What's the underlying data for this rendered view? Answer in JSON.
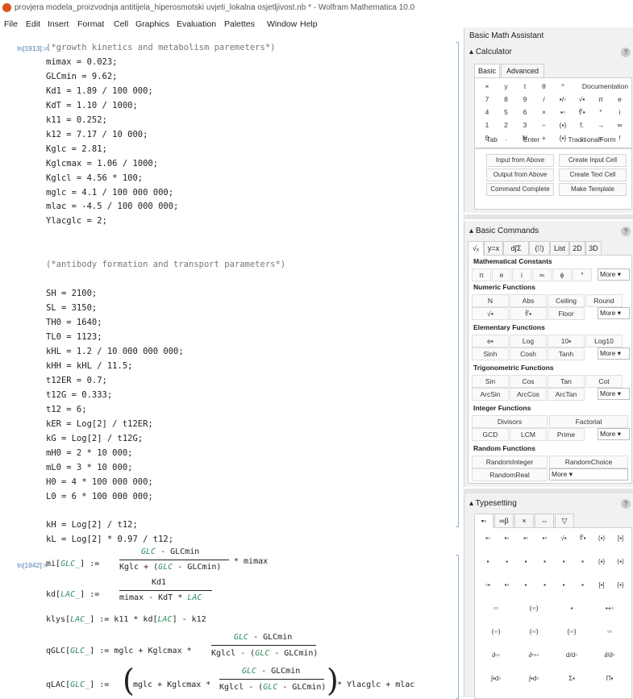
{
  "window_title": "provjera modela_proizvodnja antitijela_hiperosmotski uvjeti_lokalna osjetljivost.nb * - Wolfram Mathematica 10.0",
  "menu": [
    "File",
    "Edit",
    "Insert",
    "Format",
    "Cell",
    "Graphics",
    "Evaluation",
    "Palettes",
    "Window",
    "Help"
  ],
  "cell1": {
    "label": "In[1913]:=",
    "lines": [
      "(*growth kinetics and metabolism paremeters*)",
      "mimax = 0.023;",
      "GLCmin = 9.62;",
      "Kd1 = 1.89 / 100 000;",
      "KdT = 1.10 / 1000;",
      "k11 = 0.252;",
      "k12 = 7.17 / 10 000;",
      "Kglc = 2.81;",
      "Kglcmax = 1.06 / 1000;",
      "Kglcl = 4.56 * 100;",
      "mglc = 4.1 / 100 000 000;",
      "mlac = -4.5 / 100 000 000;",
      "Ylacglc = 2;",
      "",
      "",
      "(*antibody formation and transport parameters*)",
      "",
      "SH = 2100;",
      "SL = 3150;",
      "TH0 = 1640;",
      "TL0 = 1123;",
      "kHL = 1.2 / 10 000 000 000;",
      "kHH = kHL / 11.5;",
      "t12ER = 0.7;",
      "t12G = 0.333;",
      "t12 = 6;",
      "kER = Log[2] / t12ER;",
      "kG = Log[2] / t12G;",
      "mH0 = 2 * 10 000;",
      "mL0 = 3 * 10 000;",
      "H0 = 4 * 100 000 000;",
      "L0 = 6 * 100 000 000;",
      "",
      "kH = Log[2] / t12;",
      "kL = Log[2] * 0.97 / t12;"
    ]
  },
  "cell2": {
    "label": "In[1942]:=",
    "mi_lhs": "mi[",
    "mi_arg": "GLC_",
    "mi_rb": "] :=",
    "mi_num_a": "GLC",
    "mi_num_b": " - GLCmin",
    "mi_den_a": "Kglc + (",
    "mi_den_b": "GLC",
    "mi_den_c": " - GLCmin)",
    "mi_tail": "* mimax",
    "kd_lhs": "kd[",
    "kd_arg": "LAC_",
    "kd_rb": "] :=",
    "kd_num": "Kd1",
    "kd_den_a": "mimax - KdT *",
    "kd_den_b": "LAC",
    "klys_a": "klys[",
    "klys_arg": "LAC_",
    "klys_b": "] := k11 * kd[",
    "klys_arg2": "LAC",
    "klys_c": "] - k12",
    "q1_lhs": "qGLC[",
    "q1_arg": "GLC_",
    "q1_mid": "] := mglc + Kglcmax *",
    "q1_num_a": "GLC",
    "q1_num_b": " - GLCmin",
    "q1_den_a": "Kglcl - (",
    "q1_den_b": "GLC",
    "q1_den_c": " - GLCmin)",
    "q2_lhs": "qLAC[",
    "q2_arg": "GLC_",
    "q2_mid": "] := ",
    "q2_in": "mglc + Kglcmax *",
    "q2_num_a": "GLC",
    "q2_num_b": " - GLCmin",
    "q2_den_a": "Kglcl - (",
    "q2_den_b": "GLC",
    "q2_den_c": " - GLCmin)",
    "q2_tail": "* Ylacglc + mlac"
  },
  "assistant": {
    "title": "Basic Math Assistant",
    "calc": {
      "head": "Calculator",
      "tabs": [
        "Basic",
        "Advanced"
      ],
      "rows": [
        [
          "×",
          "y",
          "t",
          "θ",
          "^",
          "Documentation"
        ],
        [
          "7",
          "8",
          "9",
          "/",
          "▪/▫",
          "√▪",
          "π",
          "e"
        ],
        [
          "4",
          "5",
          "6",
          "×",
          "▪▫",
          "∜▪",
          "°",
          "i"
        ],
        [
          "1",
          "2",
          "3",
          "−",
          "(▪)",
          "f.",
          "→",
          "∞"
        ],
        [
          "0",
          ".",
          "N",
          "+",
          "{▪}",
          ",",
          "=",
          "!"
        ]
      ],
      "bottom": [
        "Tab",
        "Enter",
        "TraditionalForm"
      ],
      "btns": [
        "Input from Above",
        "Create Input Cell",
        "Output from Above",
        "Create Text Cell",
        "Command Complete",
        "Make Template"
      ]
    },
    "commands": {
      "head": "Basic Commands",
      "tabs": [
        "√ₓ",
        "y=x",
        "d∫Σ",
        "(⁞⁞)",
        "List",
        "2D",
        "3D"
      ],
      "const_head": "Mathematical Constants",
      "consts": [
        "π",
        "e",
        "i",
        "∞",
        "ϕ",
        "°"
      ],
      "more": "More",
      "num_head": "Numeric Functions",
      "num": [
        "N",
        "Abs",
        "Ceiling",
        "Round",
        "√▪",
        "∛▪",
        "Floor"
      ],
      "elem_head": "Elementary Functions",
      "elem": [
        "e▪",
        "Log",
        "10▪",
        "Log10",
        "Sinh",
        "Cosh",
        "Tanh"
      ],
      "trig_head": "Trigonometric Functions",
      "trig": [
        "Sin",
        "Cos",
        "Tan",
        "Cot",
        "ArcSin",
        "ArcCos",
        "ArcTan"
      ],
      "int_head": "Integer Functions",
      "int": [
        "Divisors",
        "Factorial",
        "GCD",
        "LCM",
        "Prime"
      ],
      "rand_head": "Random Functions",
      "rand": [
        "RandomInteger",
        "RandomChoice",
        "RandomReal"
      ]
    },
    "typesetting": {
      "head": "Typesetting",
      "tabs": [
        "▪▫",
        "∞β",
        "×",
        "⇔",
        "▽"
      ],
      "rows": [
        [
          "▪▫",
          "▪▫",
          "▪▫",
          "▪▫",
          "√▪",
          "∜▪",
          "(▪)",
          "[▪]"
        ],
        [
          "▪",
          "▪",
          "▪",
          "▪",
          "▪",
          "▪",
          "(▪)",
          "⟨▪⟩"
        ],
        [
          "▫▪",
          "▪▫",
          "▪",
          "▪",
          "▪",
          "▪",
          "[▪]",
          "{▪}"
        ],
        [
          "▫▫",
          "(▫▫)",
          "▪",
          "▪+▫"
        ],
        [
          "(▫▫)",
          "(▫▫)",
          "{▫▫}",
          "▫▫"
        ],
        [
          "∂▫▫",
          "∂▫▫▫",
          "d/d▫",
          "∂/∂▫"
        ],
        [
          "∫▪d▫",
          "∫▪d▫",
          "Σ▪",
          "Π▪"
        ]
      ]
    }
  }
}
